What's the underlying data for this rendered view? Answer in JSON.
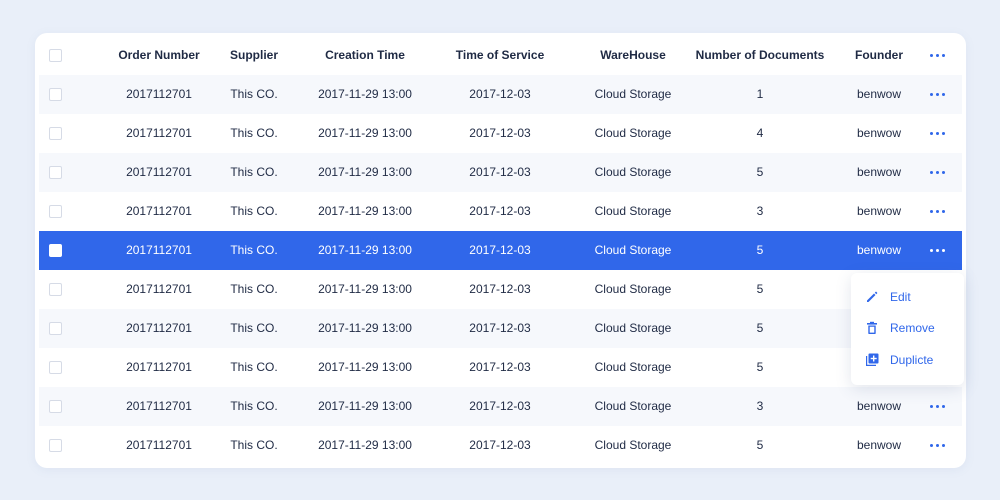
{
  "table": {
    "columns": [
      "Order Number",
      "Supplier",
      "Creation Time",
      "Time of Service",
      "WareHouse",
      "Number of Documents",
      "Founder"
    ],
    "rows": [
      [
        "2017112701",
        "This CO.",
        "2017-11-29  13:00",
        "2017-12-03",
        "Cloud Storage",
        "1",
        "benwow"
      ],
      [
        "2017112701",
        "This CO.",
        "2017-11-29  13:00",
        "2017-12-03",
        "Cloud Storage",
        "4",
        "benwow"
      ],
      [
        "2017112701",
        "This CO.",
        "2017-11-29  13:00",
        "2017-12-03",
        "Cloud Storage",
        "5",
        "benwow"
      ],
      [
        "2017112701",
        "This CO.",
        "2017-11-29  13:00",
        "2017-12-03",
        "Cloud Storage",
        "3",
        "benwow"
      ],
      [
        "2017112701",
        "This CO.",
        "2017-11-29  13:00",
        "2017-12-03",
        "Cloud Storage",
        "5",
        "benwow"
      ],
      [
        "2017112701",
        "This CO.",
        "2017-11-29  13:00",
        "2017-12-03",
        "Cloud Storage",
        "5",
        ""
      ],
      [
        "2017112701",
        "This CO.",
        "2017-11-29  13:00",
        "2017-12-03",
        "Cloud Storage",
        "5",
        ""
      ],
      [
        "2017112701",
        "This CO.",
        "2017-11-29  13:00",
        "2017-12-03",
        "Cloud Storage",
        "5",
        ""
      ],
      [
        "2017112701",
        "This CO.",
        "2017-11-29  13:00",
        "2017-12-03",
        "Cloud Storage",
        "3",
        "benwow"
      ],
      [
        "2017112701",
        "This CO.",
        "2017-11-29  13:00",
        "2017-12-03",
        "Cloud Storage",
        "5",
        "benwow"
      ]
    ],
    "selected_row": 4,
    "more_icon": "more-horizontal-icon"
  },
  "context_menu": {
    "items": [
      {
        "label": "Edit",
        "icon": "pencil-icon"
      },
      {
        "label": "Remove",
        "icon": "trash-icon"
      },
      {
        "label": "Duplicte",
        "icon": "duplicate-icon"
      }
    ]
  },
  "colors": {
    "accent": "#3067ea",
    "background": "#e9eff9",
    "stripe": "#f6f8fc",
    "text": "#1f2a44"
  }
}
